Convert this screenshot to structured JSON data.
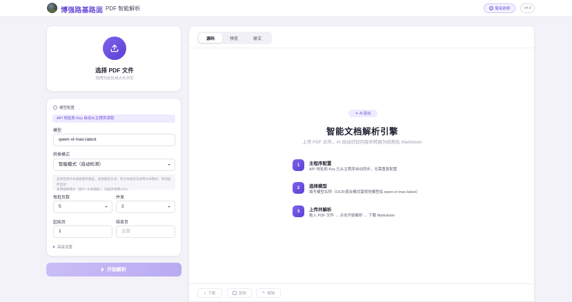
{
  "header": {
    "brand": "博强路基路面",
    "breadcrumb_sep": "/",
    "breadcrumb": "PDF 智能解析",
    "help_label": "使用说明",
    "version": "v4.0"
  },
  "upload": {
    "title": "选择 PDF 文件",
    "subtitle": "拖拽到此处或点击浏览"
  },
  "config": {
    "section_title": "模型配置",
    "notice": "API 地址和 Key 自动从主程序读取",
    "model_label": "模型",
    "model_value": "qwen-vl-max-latest",
    "mode_label": "转换模式",
    "mode_value": "智能模式（自动检测）",
    "mode_hint_line1": "自动检测文本层质量和类型，选择最优方式：有文本层优先采用文本模式；有扫描件自动",
    "mode_hint_line2": "采用图像模式（图片+文本辅助）；扫描件使用OCR。",
    "pages_label": "每批页数",
    "pages_value": "5",
    "concurrency_label": "并发",
    "concurrency_value": "2",
    "start_page_label": "起始页",
    "start_page_value": "1",
    "end_page_label": "结束页",
    "end_page_placeholder": "全部",
    "advanced_label": "高级设置"
  },
  "start_button": "开始解析",
  "tabs": [
    {
      "label": "源码",
      "active": true
    },
    {
      "label": "预览",
      "active": false
    },
    {
      "label": "原文",
      "active": false
    }
  ],
  "hero": {
    "badge": "AI 驱动",
    "title": "智能文档解析引擎",
    "subtitle": "上传 PDF 文件，AI 自动识别内容并转换为结构化 Markdown"
  },
  "steps": [
    {
      "num": "1",
      "title": "主程序配置",
      "desc": "API 地址和 Key 已从主程序自动同步，无需重复配置"
    },
    {
      "num": "2",
      "title": "选择模型",
      "desc": "填写模型名称（OCR/混合模式需视觉模型如 qwen-vl-max-latest）"
    },
    {
      "num": "3",
      "title": "上传并解析",
      "desc": "拖入 PDF 文件 → 点击开始解析 → 下载 Markdown"
    }
  ],
  "footer": {
    "download": "下载",
    "copy": "复制",
    "edit": "编辑"
  },
  "colors": {
    "accent": "#6a4fd8",
    "background": "#f3f2f8",
    "start_button": "#c3b6f5"
  }
}
